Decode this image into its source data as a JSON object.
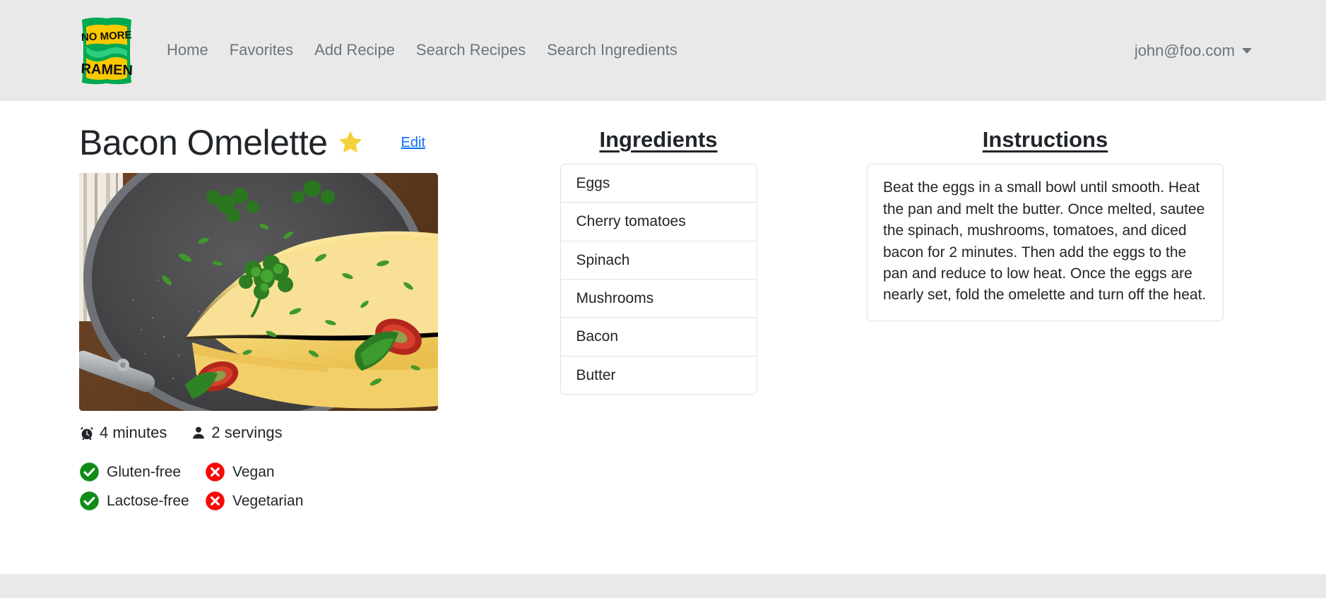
{
  "header": {
    "logo_alt": "No More Ramen",
    "logo_line1": "NO MORE",
    "logo_line2": "RAMEN",
    "nav": [
      {
        "label": "Home"
      },
      {
        "label": "Favorites"
      },
      {
        "label": "Add Recipe"
      },
      {
        "label": "Search Recipes"
      },
      {
        "label": "Search Ingredients"
      }
    ],
    "account_email": "john@foo.com"
  },
  "recipe": {
    "title": "Bacon Omelette",
    "favorited": true,
    "edit_label": "Edit",
    "time": "4 minutes",
    "servings": "2 servings",
    "diet": [
      {
        "label": "Gluten-free",
        "status": "yes"
      },
      {
        "label": "Vegan",
        "status": "no"
      },
      {
        "label": "Lactose-free",
        "status": "yes"
      },
      {
        "label": "Vegetarian",
        "status": "no"
      }
    ]
  },
  "ingredients": {
    "heading": "Ingredients",
    "items": [
      {
        "name": "Eggs"
      },
      {
        "name": "Cherry tomatoes"
      },
      {
        "name": "Spinach"
      },
      {
        "name": "Mushrooms"
      },
      {
        "name": "Bacon"
      },
      {
        "name": "Butter"
      }
    ]
  },
  "instructions": {
    "heading": "Instructions",
    "body": "Beat the eggs in a small bowl until smooth. Heat the pan and melt the butter. Once melted, sautee the spinach, mushrooms, tomatoes, and diced bacon for 2 minutes. Then add the eggs to the pan and reduce to low heat. Once the eggs are nearly set, fold the omelette and turn off the heat."
  },
  "colors": {
    "header_bg": "#e9e9e9",
    "nav_text": "#6c757d",
    "link": "#0d6efd",
    "star": "#f5d13b",
    "yes": "#0f8b18",
    "no": "#fb0707",
    "border": "#dee2e6",
    "text": "#212529"
  }
}
